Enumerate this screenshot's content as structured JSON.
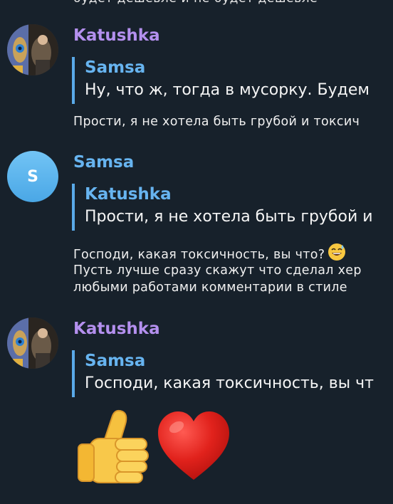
{
  "top_clipped_text": "будет дешевле и не будет дешевле",
  "messages": [
    {
      "sender": "Katushka",
      "reply": {
        "author": "Samsa",
        "text": "Ну, что ж, тогда в мусорку.  Будем"
      },
      "text_lines": [
        "Прости, я не хотела быть грубой и токсич"
      ]
    },
    {
      "sender": "Samsa",
      "avatar_letter": "S",
      "reply": {
        "author": "Katushka",
        "text": "Прости, я не хотела быть грубой и"
      },
      "text_lines": [
        "Господи, какая токсичность, вы что?",
        "Пусть лучше сразу скажут что сделал хер",
        "любыми работами комментарии в стиле"
      ]
    },
    {
      "sender": "Katushka",
      "reply": {
        "author": "Samsa",
        "text": "Господи, какая токсичность, вы чт"
      },
      "stickers": [
        "thumbs-up",
        "red-heart"
      ]
    }
  ],
  "colors": {
    "background": "#17212b",
    "sender_katushka": "#b490ee",
    "sender_samsa": "#67b4f0",
    "reply_bar": "#5aa9e8"
  }
}
